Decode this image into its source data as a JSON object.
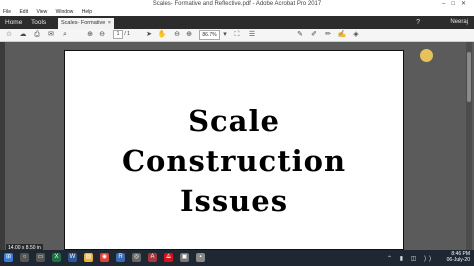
{
  "window": {
    "title": "Scales- Formative and Reflective.pdf - Adobe Acrobat Pro 2017",
    "controls": [
      "–",
      "□",
      "✕"
    ]
  },
  "menu": [
    "File",
    "Edit",
    "View",
    "Window",
    "Help"
  ],
  "tabs": {
    "home": "Home",
    "tools": "Tools",
    "document": "Scales- Formative a...",
    "close": "×"
  },
  "user": {
    "name": "Neeraj"
  },
  "toolbar": {
    "current_page": "1",
    "page_separator": "/",
    "total_pages": "1",
    "zoom": "86.7%",
    "icons": [
      "save-icon",
      "cloud-upload-icon",
      "print-icon",
      "email-icon",
      "search-icon",
      "page-up-icon",
      "page-down-icon",
      "select-cursor-icon",
      "hand-icon",
      "zoom-out-icon",
      "zoom-in-icon",
      "zoom-dropdown-icon",
      "fit-page-icon",
      "scroll-mode-icon",
      "sticky-note-icon",
      "pen-icon",
      "highlight-icon",
      "sign-icon",
      "fill-icon"
    ]
  },
  "document": {
    "line1": "Scale",
    "line2": "Construction",
    "line3": "Issues"
  },
  "page_size_tip": "14.00 x 8.50 in",
  "taskbar": {
    "time": "8:46 PM",
    "date": "06-July-20",
    "apps": [
      "windows",
      "search",
      "task-view",
      "excel",
      "word",
      "file-explorer",
      "chrome",
      "r",
      "camera",
      "access",
      "acrobat",
      "store",
      "app"
    ]
  },
  "colors": {
    "accent_cursor": "#e7c25a",
    "tabbar": "#2c2c2c",
    "taskbar": "#1f2733"
  }
}
